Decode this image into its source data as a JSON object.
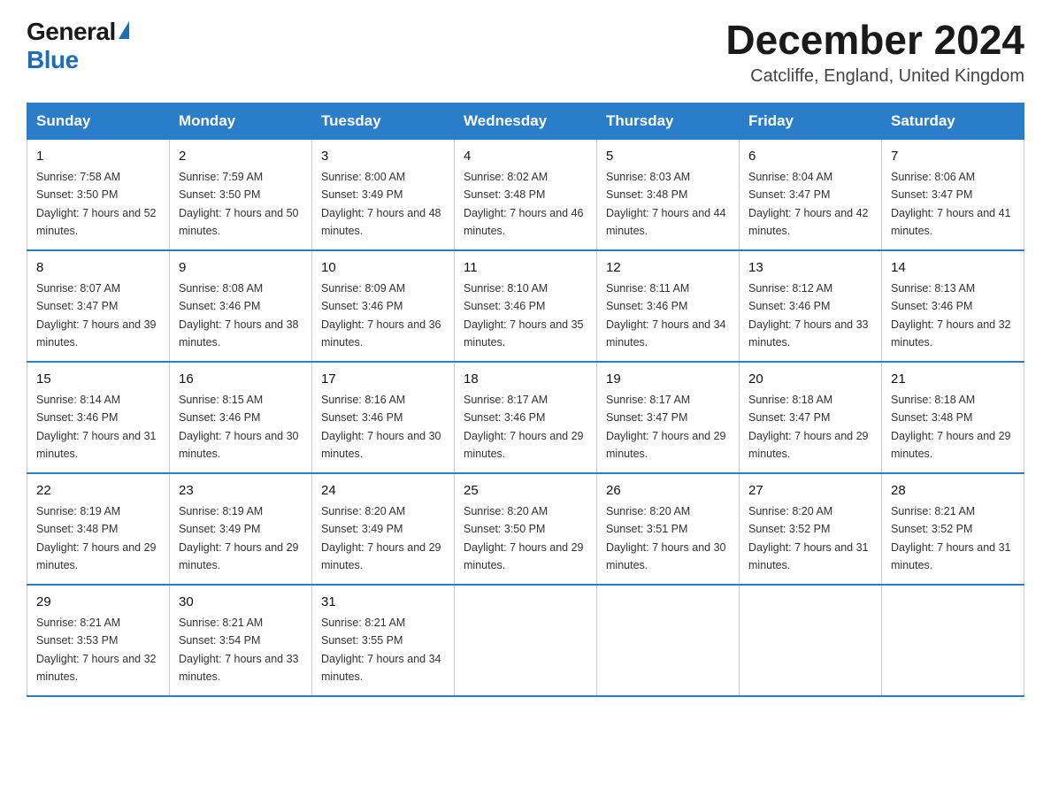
{
  "header": {
    "logo_general": "General",
    "logo_blue": "Blue",
    "title": "December 2024",
    "location": "Catcliffe, England, United Kingdom"
  },
  "days_of_week": [
    "Sunday",
    "Monday",
    "Tuesday",
    "Wednesday",
    "Thursday",
    "Friday",
    "Saturday"
  ],
  "weeks": [
    [
      {
        "day": "1",
        "sunrise": "7:58 AM",
        "sunset": "3:50 PM",
        "daylight": "7 hours and 52 minutes."
      },
      {
        "day": "2",
        "sunrise": "7:59 AM",
        "sunset": "3:50 PM",
        "daylight": "7 hours and 50 minutes."
      },
      {
        "day": "3",
        "sunrise": "8:00 AM",
        "sunset": "3:49 PM",
        "daylight": "7 hours and 48 minutes."
      },
      {
        "day": "4",
        "sunrise": "8:02 AM",
        "sunset": "3:48 PM",
        "daylight": "7 hours and 46 minutes."
      },
      {
        "day": "5",
        "sunrise": "8:03 AM",
        "sunset": "3:48 PM",
        "daylight": "7 hours and 44 minutes."
      },
      {
        "day": "6",
        "sunrise": "8:04 AM",
        "sunset": "3:47 PM",
        "daylight": "7 hours and 42 minutes."
      },
      {
        "day": "7",
        "sunrise": "8:06 AM",
        "sunset": "3:47 PM",
        "daylight": "7 hours and 41 minutes."
      }
    ],
    [
      {
        "day": "8",
        "sunrise": "8:07 AM",
        "sunset": "3:47 PM",
        "daylight": "7 hours and 39 minutes."
      },
      {
        "day": "9",
        "sunrise": "8:08 AM",
        "sunset": "3:46 PM",
        "daylight": "7 hours and 38 minutes."
      },
      {
        "day": "10",
        "sunrise": "8:09 AM",
        "sunset": "3:46 PM",
        "daylight": "7 hours and 36 minutes."
      },
      {
        "day": "11",
        "sunrise": "8:10 AM",
        "sunset": "3:46 PM",
        "daylight": "7 hours and 35 minutes."
      },
      {
        "day": "12",
        "sunrise": "8:11 AM",
        "sunset": "3:46 PM",
        "daylight": "7 hours and 34 minutes."
      },
      {
        "day": "13",
        "sunrise": "8:12 AM",
        "sunset": "3:46 PM",
        "daylight": "7 hours and 33 minutes."
      },
      {
        "day": "14",
        "sunrise": "8:13 AM",
        "sunset": "3:46 PM",
        "daylight": "7 hours and 32 minutes."
      }
    ],
    [
      {
        "day": "15",
        "sunrise": "8:14 AM",
        "sunset": "3:46 PM",
        "daylight": "7 hours and 31 minutes."
      },
      {
        "day": "16",
        "sunrise": "8:15 AM",
        "sunset": "3:46 PM",
        "daylight": "7 hours and 30 minutes."
      },
      {
        "day": "17",
        "sunrise": "8:16 AM",
        "sunset": "3:46 PM",
        "daylight": "7 hours and 30 minutes."
      },
      {
        "day": "18",
        "sunrise": "8:17 AM",
        "sunset": "3:46 PM",
        "daylight": "7 hours and 29 minutes."
      },
      {
        "day": "19",
        "sunrise": "8:17 AM",
        "sunset": "3:47 PM",
        "daylight": "7 hours and 29 minutes."
      },
      {
        "day": "20",
        "sunrise": "8:18 AM",
        "sunset": "3:47 PM",
        "daylight": "7 hours and 29 minutes."
      },
      {
        "day": "21",
        "sunrise": "8:18 AM",
        "sunset": "3:48 PM",
        "daylight": "7 hours and 29 minutes."
      }
    ],
    [
      {
        "day": "22",
        "sunrise": "8:19 AM",
        "sunset": "3:48 PM",
        "daylight": "7 hours and 29 minutes."
      },
      {
        "day": "23",
        "sunrise": "8:19 AM",
        "sunset": "3:49 PM",
        "daylight": "7 hours and 29 minutes."
      },
      {
        "day": "24",
        "sunrise": "8:20 AM",
        "sunset": "3:49 PM",
        "daylight": "7 hours and 29 minutes."
      },
      {
        "day": "25",
        "sunrise": "8:20 AM",
        "sunset": "3:50 PM",
        "daylight": "7 hours and 29 minutes."
      },
      {
        "day": "26",
        "sunrise": "8:20 AM",
        "sunset": "3:51 PM",
        "daylight": "7 hours and 30 minutes."
      },
      {
        "day": "27",
        "sunrise": "8:20 AM",
        "sunset": "3:52 PM",
        "daylight": "7 hours and 31 minutes."
      },
      {
        "day": "28",
        "sunrise": "8:21 AM",
        "sunset": "3:52 PM",
        "daylight": "7 hours and 31 minutes."
      }
    ],
    [
      {
        "day": "29",
        "sunrise": "8:21 AM",
        "sunset": "3:53 PM",
        "daylight": "7 hours and 32 minutes."
      },
      {
        "day": "30",
        "sunrise": "8:21 AM",
        "sunset": "3:54 PM",
        "daylight": "7 hours and 33 minutes."
      },
      {
        "day": "31",
        "sunrise": "8:21 AM",
        "sunset": "3:55 PM",
        "daylight": "7 hours and 34 minutes."
      },
      null,
      null,
      null,
      null
    ]
  ],
  "labels": {
    "sunrise_prefix": "Sunrise: ",
    "sunset_prefix": "Sunset: ",
    "daylight_prefix": "Daylight: "
  }
}
